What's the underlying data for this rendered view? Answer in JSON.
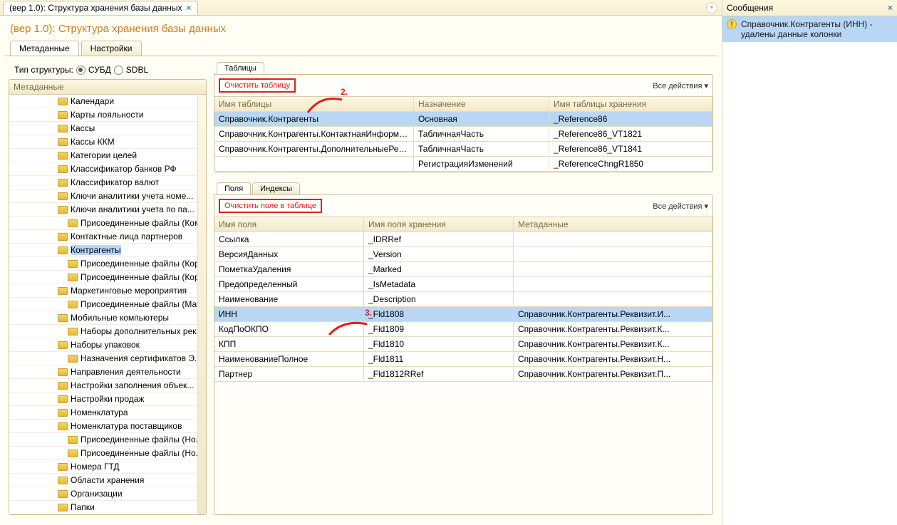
{
  "window": {
    "tab_title": "(вер 1.0): Структура хранения базы данных"
  },
  "page_title": "(вер 1.0): Структура хранения базы данных",
  "main_tabs": {
    "metadata": "Метаданные",
    "settings": "Настройки"
  },
  "struct_type": {
    "label": "Тип структуры:",
    "opt1": "СУБД",
    "opt2": "SDBL"
  },
  "metadata_header": "Метаданные",
  "tree_items": [
    {
      "t": "Календари"
    },
    {
      "t": "Карты лояльности"
    },
    {
      "t": "Кассы"
    },
    {
      "t": "Кассы ККМ"
    },
    {
      "t": "Категории целей"
    },
    {
      "t": "Классификатор банков РФ"
    },
    {
      "t": "Классификатор валют"
    },
    {
      "t": "Ключи аналитики учета номе..."
    },
    {
      "t": "Ключи аналитики учета по па..."
    },
    {
      "t": "Присоединенные файлы (Ком...",
      "i": 1
    },
    {
      "t": "Контактные лица партнеров"
    },
    {
      "t": "Контрагенты",
      "sel": 1
    },
    {
      "t": "Присоединенные файлы (Кор...",
      "i": 1
    },
    {
      "t": "Присоединенные файлы (Кор...",
      "i": 1
    },
    {
      "t": "Маркетинговые мероприятия"
    },
    {
      "t": "Присоединенные файлы (Мар...",
      "i": 1
    },
    {
      "t": "Мобильные компьютеры"
    },
    {
      "t": "Наборы дополнительных рек...",
      "i": 1
    },
    {
      "t": "Наборы упаковок"
    },
    {
      "t": "Назначения сертификатов Э...",
      "i": 1
    },
    {
      "t": "Направления деятельности"
    },
    {
      "t": "Настройки заполнения объек..."
    },
    {
      "t": "Настройки продаж"
    },
    {
      "t": "Номенклатура"
    },
    {
      "t": "Номенклатура поставщиков"
    },
    {
      "t": "Присоединенные файлы (Но...",
      "i": 1
    },
    {
      "t": "Присоединенные файлы (Но...",
      "i": 1
    },
    {
      "t": "Номера ГТД"
    },
    {
      "t": "Области хранения"
    },
    {
      "t": "Организации"
    },
    {
      "t": "Папки"
    }
  ],
  "tables_section": {
    "tab": "Таблицы",
    "clear_btn": "Очистить таблицу",
    "all_actions": "Все действия ▾",
    "headers": {
      "c1": "Имя таблицы",
      "c2": "Назначение",
      "c3": "Имя таблицы хранения"
    },
    "rows": [
      {
        "c1": "Справочник.Контрагенты",
        "c2": "Основная",
        "c3": "_Reference86",
        "sel": 1
      },
      {
        "c1": "Справочник.Контрагенты.КонтактнаяИнформация",
        "c2": "ТабличнаяЧасть",
        "c3": "_Reference86_VT1821"
      },
      {
        "c1": "Справочник.Контрагенты.ДополнительныеРеквиз...",
        "c2": "ТабличнаяЧасть",
        "c3": "_Reference86_VT1841"
      },
      {
        "c1": "",
        "c2": "РегистрацияИзменений",
        "c3": "_ReferenceChngR1850"
      }
    ]
  },
  "fields_section": {
    "tab1": "Поля",
    "tab2": "Индексы",
    "clear_btn": "Очистить поле в таблице",
    "all_actions": "Все действия ▾",
    "headers": {
      "c1": "Имя поля",
      "c2": "Имя поля хранения",
      "c3": "Метаданные"
    },
    "rows": [
      {
        "c1": "Ссылка",
        "c2": "_IDRRef",
        "c3": ""
      },
      {
        "c1": "ВерсияДанных",
        "c2": "_Version",
        "c3": ""
      },
      {
        "c1": "ПометкаУдаления",
        "c2": "_Marked",
        "c3": ""
      },
      {
        "c1": "Предопределенный",
        "c2": "_IsMetadata",
        "c3": ""
      },
      {
        "c1": "Наименование",
        "c2": "_Description",
        "c3": ""
      },
      {
        "c1": "ИНН",
        "c2": "_Fld1808",
        "c3": "Справочник.Контрагенты.Реквизит.И...",
        "sel": 1
      },
      {
        "c1": "КодПоОКПО",
        "c2": "_Fld1809",
        "c3": "Справочник.Контрагенты.Реквизит.К..."
      },
      {
        "c1": "КПП",
        "c2": "_Fld1810",
        "c3": "Справочник.Контрагенты.Реквизит.К..."
      },
      {
        "c1": "НаименованиеПолное",
        "c2": "_Fld1811",
        "c3": "Справочник.Контрагенты.Реквизит.Н..."
      },
      {
        "c1": "Партнер",
        "c2": "_Fld1812RRef",
        "c3": "Справочник.Контрагенты.Реквизит.П..."
      }
    ]
  },
  "messages": {
    "title": "Сообщения",
    "item": "Справочник.Контрагенты (ИНН) - удалены данные колонки"
  },
  "annotations": {
    "a2": "2.",
    "a3": "3."
  }
}
